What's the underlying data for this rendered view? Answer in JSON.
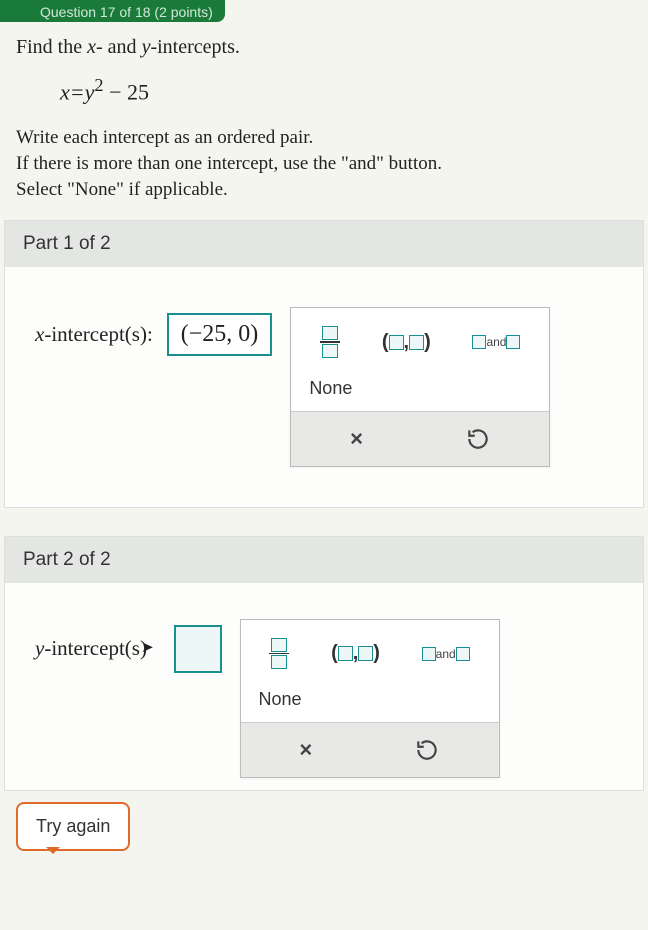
{
  "topTab": "Question 17 of 18 (2 points)",
  "prompt": "Find the x- and y-intercepts.",
  "equation": {
    "lhs": "x",
    "eq": "=",
    "rhs_var": "y",
    "rhs_exp": "2",
    "minus": " − ",
    "const": "25"
  },
  "instructions": {
    "l1": "Write each intercept as an ordered pair.",
    "l2": "If there is more than one intercept, use the \"and\" button.",
    "l3": "Select \"None\" if applicable."
  },
  "parts": {
    "p1": {
      "header": "Part 1 of 2",
      "label": "x-intercept(s):",
      "answer": "(−25, 0)"
    },
    "p2": {
      "header": "Part 2 of 2",
      "label": "y-intercept(s):",
      "answer": ""
    }
  },
  "palette": {
    "fraction": "fraction",
    "pair_open": "(",
    "pair_sep": ",",
    "pair_close": ")",
    "and": "and",
    "none": "None",
    "clear": "×",
    "reset": "↺"
  },
  "tryAgain": "Try again"
}
